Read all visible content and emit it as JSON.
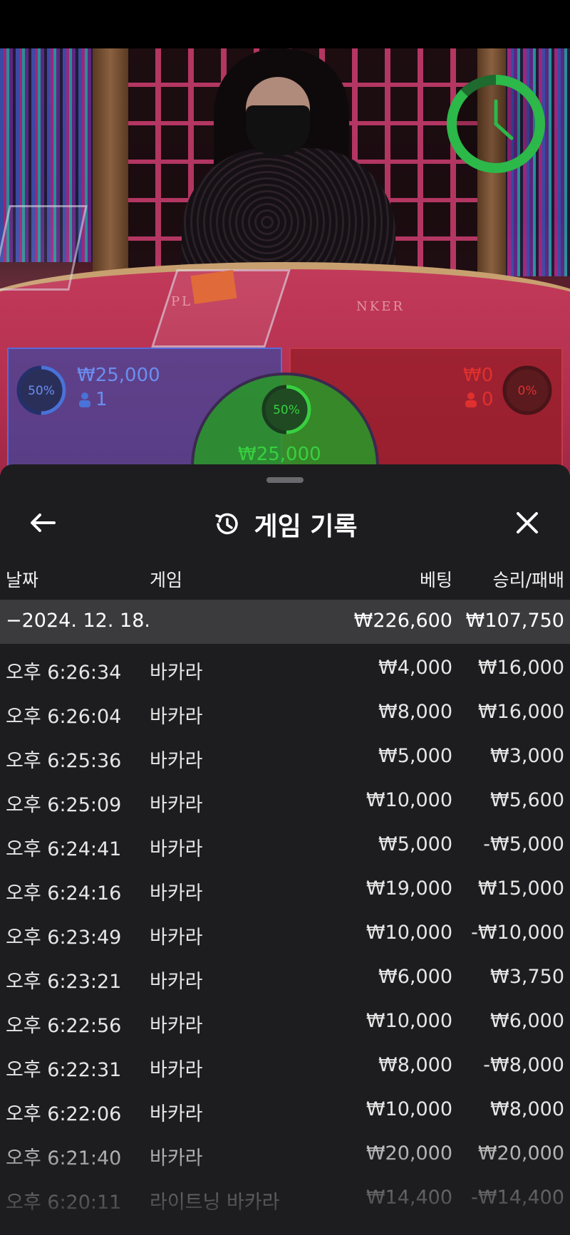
{
  "timer": {
    "color": "#2db84a"
  },
  "bets": {
    "player": {
      "percent_label": "50%",
      "percent": 50,
      "amount": "₩25,000",
      "count": "1",
      "color": "#4a72d8"
    },
    "banker": {
      "percent_label": "0%",
      "percent": 0,
      "amount": "₩0",
      "count": "0",
      "color": "#e0302e"
    },
    "tie": {
      "percent_label": "50%",
      "percent": 50,
      "amount": "₩25,000",
      "color": "#38d040"
    }
  },
  "felt": {
    "player_text": "PL",
    "banker_text": "NKER"
  },
  "sheet": {
    "title": "게임 기록",
    "columns": {
      "date": "날짜",
      "game": "게임",
      "bet": "베팅",
      "winloss": "승리/패배"
    },
    "day": {
      "date": "−2024. 12. 18.",
      "bet": "₩226,600",
      "winloss": "₩107,750"
    },
    "rows": [
      {
        "time": "오후 6:26:34",
        "game": "바카라",
        "bet": "₩4,000",
        "winloss": "₩16,000"
      },
      {
        "time": "오후 6:26:04",
        "game": "바카라",
        "bet": "₩8,000",
        "winloss": "₩16,000"
      },
      {
        "time": "오후 6:25:36",
        "game": "바카라",
        "bet": "₩5,000",
        "winloss": "₩3,000"
      },
      {
        "time": "오후 6:25:09",
        "game": "바카라",
        "bet": "₩10,000",
        "winloss": "₩5,600"
      },
      {
        "time": "오후 6:24:41",
        "game": "바카라",
        "bet": "₩5,000",
        "winloss": "-₩5,000"
      },
      {
        "time": "오후 6:24:16",
        "game": "바카라",
        "bet": "₩19,000",
        "winloss": "₩15,000"
      },
      {
        "time": "오후 6:23:49",
        "game": "바카라",
        "bet": "₩10,000",
        "winloss": "-₩10,000"
      },
      {
        "time": "오후 6:23:21",
        "game": "바카라",
        "bet": "₩6,000",
        "winloss": "₩3,750"
      },
      {
        "time": "오후 6:22:56",
        "game": "바카라",
        "bet": "₩10,000",
        "winloss": "₩6,000"
      },
      {
        "time": "오후 6:22:31",
        "game": "바카라",
        "bet": "₩8,000",
        "winloss": "-₩8,000"
      },
      {
        "time": "오후 6:22:06",
        "game": "바카라",
        "bet": "₩10,000",
        "winloss": "₩8,000"
      },
      {
        "time": "오후 6:21:40",
        "game": "바카라",
        "bet": "₩20,000",
        "winloss": "₩20,000"
      },
      {
        "time": "오후 6:20:11",
        "game": "라이트닝 바카라",
        "bet": "₩14,400",
        "winloss": "-₩14,400"
      }
    ]
  }
}
